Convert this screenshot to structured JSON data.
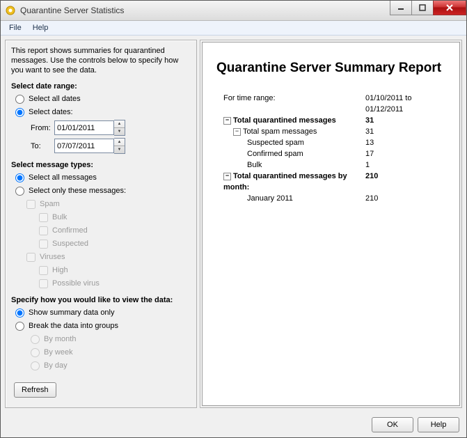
{
  "window": {
    "title": "Quarantine Server Statistics"
  },
  "menu": {
    "file": "File",
    "help": "Help"
  },
  "intro": "This report shows summaries for quarantined messages. Use the controls below to specify how you want to see the data.",
  "date_range": {
    "heading": "Select date range:",
    "opt_all": "Select all dates",
    "opt_dates": "Select dates:",
    "from_label": "From:",
    "to_label": "To:",
    "from_value": "01/01/2011",
    "to_value": "07/07/2011",
    "selected": "dates"
  },
  "msg_types": {
    "heading": "Select message types:",
    "opt_all": "Select all messages",
    "opt_only": "Select only these messages:",
    "selected": "all",
    "spam": "Spam",
    "bulk": "Bulk",
    "confirmed": "Confirmed",
    "suspected": "Suspected",
    "viruses": "Viruses",
    "high": "High",
    "possible": "Possible virus"
  },
  "view": {
    "heading": "Specify how you would like to view the data:",
    "summary": "Show summary data only",
    "groups": "Break the data into groups",
    "selected": "summary",
    "by_month": "By month",
    "by_week": "By week",
    "by_day": "By day"
  },
  "buttons": {
    "refresh": "Refresh",
    "ok": "OK",
    "help": "Help"
  },
  "report": {
    "title": "Quarantine Server Summary Report",
    "time_range_label": "For time range:",
    "time_range_value": "01/10/2011 to 01/12/2011",
    "total_label": "Total quarantined messages",
    "total_value": "31",
    "spam_label": "Total spam messages",
    "spam_value": "31",
    "suspected_label": "Suspected spam",
    "suspected_value": "13",
    "confirmed_label": "Confirmed spam",
    "confirmed_value": "17",
    "bulk_label": "Bulk",
    "bulk_value": "1",
    "by_month_label": "Total quarantined messages by month:",
    "by_month_value": "210",
    "month1_label": "January 2011",
    "month1_value": "210"
  }
}
